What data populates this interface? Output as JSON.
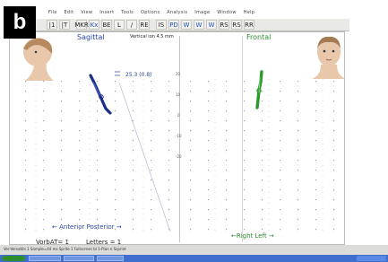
{
  "figure_label": "b",
  "menubar": {
    "items": [
      "File",
      "Edit",
      "View",
      "Insert",
      "Tools",
      "Options",
      "Analysis",
      "Image",
      "Window",
      "Help"
    ]
  },
  "toolbar": {
    "buttons": [
      "|1",
      "|T",
      "MKR",
      "Kx",
      "BE",
      "L",
      "/",
      "RE",
      "IS",
      "PD",
      "W",
      "W",
      "W",
      "RS",
      "RS",
      "RR"
    ]
  },
  "viewer": {
    "sagittal_label": "Sagittal",
    "frontal_label": "Frontal",
    "top_center_label": "Vertical ion 4.5 mm",
    "measure_label": "25.3 (0.8)",
    "anterior_posterior": "← Anterior  Posterior →",
    "right_left": "←Right   Left →",
    "vorb_label": "VorbAT= 1",
    "letters_label": "Letters = 1",
    "center_markers": [
      "20",
      "10",
      "0",
      "-10",
      "-20"
    ]
  },
  "status": {
    "line": "Ver-Versatile 1 Sample=44  ms Sprite 1 Fullscreen  bl  1-Plan  n  Ssprint"
  },
  "colors": {
    "sagittal_text": "#2c46a8",
    "frontal_text": "#2f8a2f",
    "sagittal_trace": "#1c2f86",
    "frontal_trace": "#2a9a2a",
    "grid_dot": "#9aa6b2"
  }
}
